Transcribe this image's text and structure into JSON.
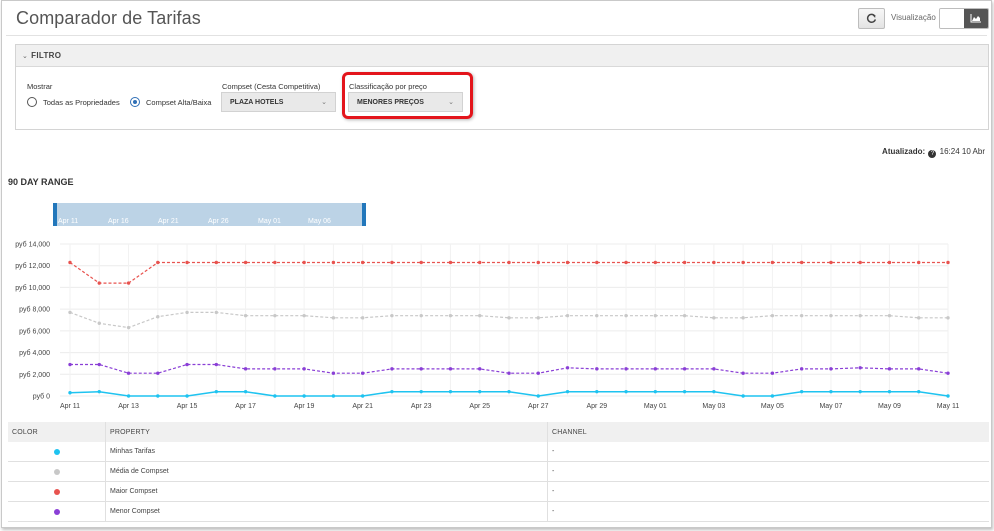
{
  "header": {
    "title": "Comparador de Tarifas",
    "visualization_label": "Visualização",
    "refresh_icon": "refresh-icon",
    "chart_icon": "area-chart-icon"
  },
  "filter": {
    "title": "FILTRO",
    "show_label": "Mostrar",
    "radio_all": "Todas as Propriedades",
    "radio_compset": "Compset Alta/Baixa",
    "compset_label": "Compset (Cesta Competitiva)",
    "compset_value": "PLAZA HOTELS",
    "sort_label": "Classificação por preço",
    "sort_value": "MENORES PREÇOS"
  },
  "updated": {
    "label": "Atualizado:",
    "value": "16:24 10 Abr"
  },
  "range": {
    "title": "90 DAY RANGE",
    "navigator_labels": [
      "Apr 11",
      "Apr 16",
      "Apr 21",
      "Apr 26",
      "May 01",
      "May 06"
    ]
  },
  "chart_data": {
    "type": "line",
    "y_tick_labels": [
      "руб 0",
      "руб 2,000",
      "руб 4,000",
      "руб 6,000",
      "руб 8,000",
      "руб 10,000",
      "руб 12,000",
      "руб 14,000"
    ],
    "ylim": [
      0,
      14000
    ],
    "x_tick_labels": [
      "Apr 11",
      "Apr 13",
      "Apr 15",
      "Apr 17",
      "Apr 19",
      "Apr 21",
      "Apr 23",
      "Apr 25",
      "Apr 27",
      "Apr 29",
      "May 01",
      "May 03",
      "May 05",
      "May 07",
      "May 09",
      "May 11"
    ],
    "x": [
      "Apr 11",
      "Apr 12",
      "Apr 13",
      "Apr 14",
      "Apr 15",
      "Apr 16",
      "Apr 17",
      "Apr 18",
      "Apr 19",
      "Apr 20",
      "Apr 21",
      "Apr 22",
      "Apr 23",
      "Apr 24",
      "Apr 25",
      "Apr 26",
      "Apr 27",
      "Apr 28",
      "Apr 29",
      "Apr 30",
      "May 01",
      "May 02",
      "May 03",
      "May 04",
      "May 05",
      "May 06",
      "May 07",
      "May 08",
      "May 09",
      "May 10",
      "May 11"
    ],
    "grid": true,
    "series": [
      {
        "name": "Maior Compset",
        "color": "#e8534f",
        "dashed": true,
        "values": [
          12300,
          10400,
          10400,
          12300,
          12300,
          12300,
          12300,
          12300,
          12300,
          12300,
          12300,
          12300,
          12300,
          12300,
          12300,
          12300,
          12300,
          12300,
          12300,
          12300,
          12300,
          12300,
          12300,
          12300,
          12300,
          12300,
          12300,
          12300,
          12300,
          12300,
          12300
        ]
      },
      {
        "name": "Média de Compset",
        "color": "#c8c8c8",
        "dashed": true,
        "values": [
          7700,
          6700,
          6300,
          7300,
          7700,
          7700,
          7400,
          7400,
          7400,
          7200,
          7200,
          7400,
          7400,
          7400,
          7400,
          7200,
          7200,
          7400,
          7400,
          7400,
          7400,
          7400,
          7200,
          7200,
          7400,
          7400,
          7400,
          7400,
          7400,
          7200,
          7200
        ]
      },
      {
        "name": "Menor Compset",
        "color": "#8a3fd6",
        "dashed": true,
        "values": [
          2900,
          2900,
          2100,
          2100,
          2900,
          2900,
          2500,
          2500,
          2500,
          2100,
          2100,
          2500,
          2500,
          2500,
          2500,
          2100,
          2100,
          2600,
          2500,
          2500,
          2500,
          2500,
          2500,
          2100,
          2100,
          2500,
          2500,
          2600,
          2500,
          2500,
          2100
        ]
      },
      {
        "name": "Minhas Tarifas",
        "color": "#1ec3f0",
        "dashed": false,
        "values": [
          300,
          400,
          -200,
          -200,
          -200,
          400,
          400,
          -200,
          -200,
          -200,
          -200,
          400,
          400,
          400,
          400,
          400,
          -200,
          400,
          400,
          400,
          400,
          400,
          400,
          -200,
          -200,
          400,
          400,
          400,
          400,
          400,
          -200
        ]
      }
    ]
  },
  "table": {
    "headers": {
      "color": "COLOR",
      "property": "PROPERTY",
      "channel": "CHANNEL"
    },
    "rows": [
      {
        "color": "#1ec3f0",
        "property": "Minhas Tarifas",
        "channel": "-"
      },
      {
        "color": "#c8c8c8",
        "property": "Média de Compset",
        "channel": "-"
      },
      {
        "color": "#e8534f",
        "property": "Maior Compset",
        "channel": "-"
      },
      {
        "color": "#8a3fd6",
        "property": "Menor Compset",
        "channel": "-"
      }
    ]
  }
}
